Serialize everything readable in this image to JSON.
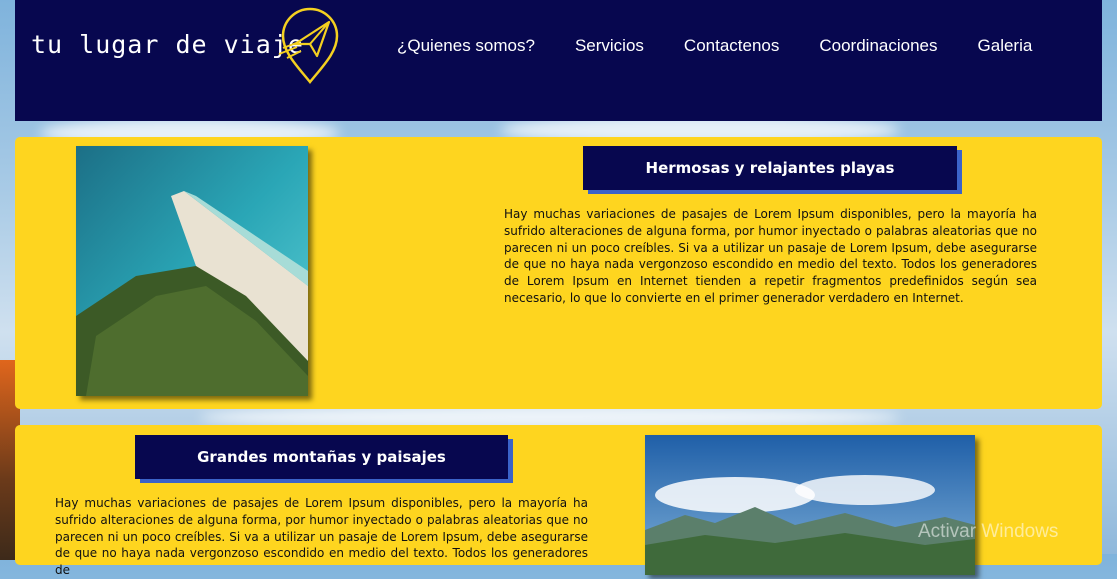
{
  "header": {
    "logo_text": "tu lugar de viaje",
    "nav": [
      "¿Quienes somos?",
      "Servicios",
      "Contactenos",
      "Coordinaciones",
      "Galeria"
    ]
  },
  "sections": [
    {
      "title": "Hermosas y relajantes playas",
      "text": "Hay muchas variaciones de pasajes de Lorem Ipsum disponibles, pero la mayoría ha sufrido alteraciones de alguna forma, por humor inyectado o palabras aleatorias que no parecen ni un poco creíbles. Si va a utilizar un pasaje de Lorem Ipsum, debe asegurarse de que no haya nada vergonzoso escondido en medio del texto. Todos los generadores de Lorem Ipsum en Internet tienden a repetir fragmentos predefinidos según sea necesario, lo que lo convierte en el primer generador verdadero en Internet."
    },
    {
      "title": "Grandes montañas y paisajes",
      "text": "Hay muchas variaciones de pasajes de Lorem Ipsum disponibles, pero la mayoría ha sufrido alteraciones de alguna forma, por humor inyectado o palabras aleatorias que no parecen ni un poco creíbles. Si va a utilizar un pasaje de Lorem Ipsum, debe asegurarse de que no haya nada vergonzoso escondido en medio del texto. Todos los generadores de"
    }
  ],
  "watermark": "Activar Windows",
  "colors": {
    "header_bg": "#07074f",
    "card_bg": "#fed51f",
    "accent": "#3b63c9",
    "logo_yellow": "#f4d020"
  }
}
